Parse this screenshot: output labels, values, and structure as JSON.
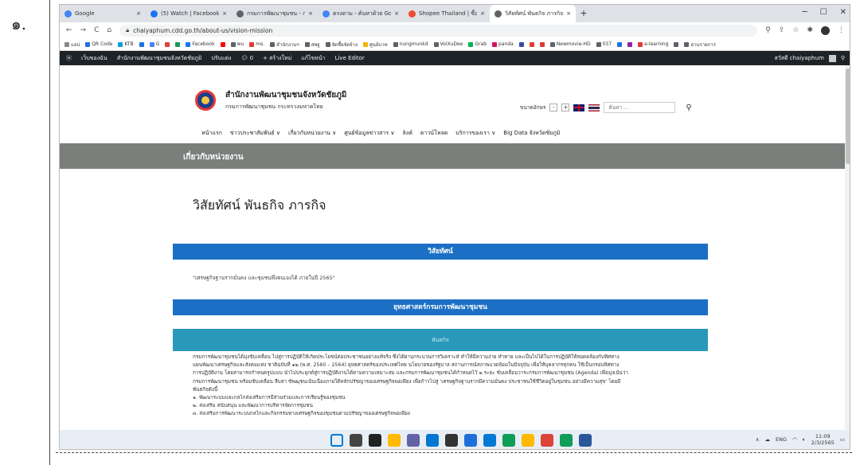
{
  "doc": {
    "label": "๑."
  },
  "browser": {
    "tabs": [
      {
        "title": "Google",
        "color": "#4285f4"
      },
      {
        "title": "(5) Watch | Facebook",
        "color": "#1877f2"
      },
      {
        "title": "กรมการพัฒนาชุมชน - กระทรวงมหาดไทย",
        "color": "#5f6368"
      },
      {
        "title": "ตรงตาม - ค้นหาด้วย Google",
        "color": "#4285f4"
      },
      {
        "title": "Shopee Thailand | ซื้อขายผ่านมือถือ",
        "color": "#ee4d2d"
      },
      {
        "title": "วิสัยทัศน์ พันธกิจ ภารกิจ - สำนักงานฯ",
        "color": "#5f6368"
      }
    ],
    "new_tab": "+",
    "url": "chaiyaphum.cdd.go.th/about-us/vision-mission",
    "bookmarks": [
      {
        "label": "แอป",
        "color": "#888888"
      },
      {
        "label": "QR Code",
        "color": "#1a73e8"
      },
      {
        "label": "KTB",
        "color": "#00a1e0"
      },
      {
        "label": "",
        "color": "#1a73e8"
      },
      {
        "label": "G",
        "color": "#4285f4"
      },
      {
        "label": "",
        "color": "#db4437"
      },
      {
        "label": "",
        "color": "#0f9d58"
      },
      {
        "label": "Facebook",
        "color": "#1877f2"
      },
      {
        "label": "",
        "color": "#ff0000"
      },
      {
        "label": "wu",
        "color": "#5f6368"
      },
      {
        "label": "ms.",
        "color": "#e53935"
      },
      {
        "label": "สำนักงานฯ",
        "color": "#5f6368"
      },
      {
        "label": "สพฐ",
        "color": "#5f6368"
      },
      {
        "label": "จัดซื้อจัดจ้าง",
        "color": "#5f6368"
      },
      {
        "label": "ศูนย์บาท",
        "color": "#f4b400"
      },
      {
        "label": "nungmunkd",
        "color": "#5f6368"
      },
      {
        "label": "VoiXuDee",
        "color": "#5f6368"
      },
      {
        "label": "Grab",
        "color": "#00b14f"
      },
      {
        "label": "panda",
        "color": "#d70f64"
      },
      {
        "label": "",
        "color": "#3949ab"
      },
      {
        "label": "",
        "color": "#e53935"
      },
      {
        "label": "",
        "color": "#e53935"
      },
      {
        "label": "Newmovie-HD",
        "color": "#5f6368"
      },
      {
        "label": "037",
        "color": "#5f6368"
      },
      {
        "label": "",
        "color": "#1a73e8"
      },
      {
        "label": "",
        "color": "#8e24aa"
      },
      {
        "label": "e-learning",
        "color": "#e53935"
      },
      {
        "label": "",
        "color": "#5f6368"
      },
      {
        "label": "อ่านรายการ",
        "color": "#5f6368"
      }
    ]
  },
  "wp": {
    "items": [
      "เว็บของฉัน",
      "สำนักงานพัฒนาชุมชนจังหวัดชัยภูมิ",
      "ปรับแต่ง",
      "0",
      "สร้างใหม่",
      "แก้ไขหน้า",
      "Live Editor"
    ],
    "greeting": "สวัสดี chaiyaphum"
  },
  "site": {
    "org_name": "สำนักงานพัฒนาชุมชนจังหวัดชัยภูมิ",
    "org_sub": "กรมการพัฒนาชุมชน กระทรวงมหาดไทย",
    "font_size_label": "ขนาดอักษร",
    "font_minus": "-",
    "font_plus": "+",
    "search_placeholder": "ค้นหา ...",
    "nav": [
      "หน้าแรก",
      "ข่าวประชาสัมพันธ์ ∨",
      "เกี่ยวกับหน่วยงาน ∨",
      "ศูนย์ข้อมูลข่าวสาร ∨",
      "ลิงค์",
      "ดาวน์โหลด",
      "บริการของเรา ∨",
      "Big Data จังหวัดชัยภูมิ"
    ],
    "band_title": "เกี่ยวกับหน่วยงาน",
    "page_title": "วิสัยทัศน์ พันธกิจ ภารกิจ",
    "vision_header": "วิสัยทัศน์",
    "vision_text": "\"เศรษฐกิจฐานรากมั่นคง และชุมชนพึ่งตนเองได้ ภายในปี 2565\"",
    "strategy_header": "ยุทธศาสตร์กรมการพัฒนาชุมชน",
    "mission_header": "พันธกิจ",
    "para_lines": [
      "กรมการพัฒนาชุมชนได้มุ่งขับเคลื่อน ไปสู่การปฏิบัติให้เกิดประโยชน์ต่อประชาชนอย่างแท้จริง ซึ่งได้ผ่านกระบวนการวิเคราะห์ ทำให้มีความง่าย ทำทาย และเป็นไปได้ในการปฏิบัติให้สอดคล้องกับทิศทาง",
      "แผนพัฒนาเศรษฐกิจและสังคมแห่ง ชาติฉบับที่ ๑๒ (พ.ศ. 2560 – 2564) ยุทธศาสตร์ของประเทศไทย นโยบายของรัฐบาล สถานการณ์สภาพแวดล้อมในปัจจุบัน เพื่อให้บุคลากรทุกคน ใช้เป็นกรอบทิศทาง",
      "การปฏิบัติงาน โดยสามารถกำหนดรูปแบบ นำไปประยุกต์สู่การปฏิบัติงานได้ตามความเหมาะสม และกรมการพัฒนาชุมชนได้กำหนดไว้ ๒ ระยะ ขับเคลื่อนวาระกรมการพัฒนาชุมชน (Agenda) เพื่อมุ่งเน้นว่า",
      "กรมการพัฒนาชุมชน พร้อมขับเคลื่อน สืบสา ขัพฒุชนเน้นเนื่องภายใต้หลักปรัชญาของเศรษฐกิจพอเพียง เพื่อก้าวไปสู่ 'เศรษฐกิจฐานรากมีความมั่นคง ประชาชนใช้ชีวิตอยู่ในชุมชน อย่างมีความสุข' โดยมี",
      "พันธกิจดังนี้",
      "๑. พัฒนาระบบและกลไกส่งเสริมการมีส่วนร่วมและการเรียนรู้ของชุมชน",
      "๒. ส่งเสริม สนับสนุน และพัฒนาการบริหารจัดการชุมชน",
      "๓. ส่งเสริมการพัฒนาระบบกลไกและกิจกรรมทางเศรษฐกิจของชุมชนตามปรัชญาของเศรษฐกิจพอเพียง"
    ]
  },
  "taskbar": {
    "app_colors": [
      "#0078d4",
      "#444444",
      "#222222",
      "#ffb900",
      "#6264a7",
      "#0078d4",
      "#333333",
      "#1e6fd9",
      "#0078d4",
      "#0f9d58",
      "#ffb900",
      "#db4437",
      "#0f9d58",
      "#2b579a"
    ],
    "tray_lang": "ENG",
    "time": "11:09",
    "date": "2/3/2565"
  }
}
